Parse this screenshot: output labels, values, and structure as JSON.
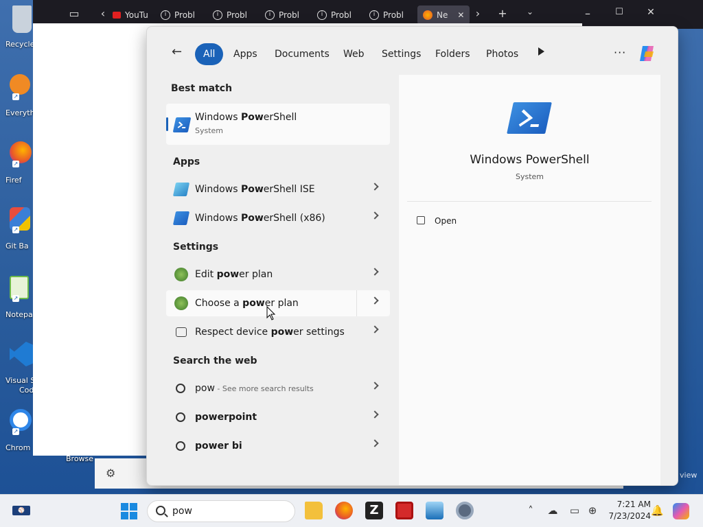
{
  "desktop": {
    "icons": [
      {
        "label": "Recycle",
        "color": "#9aa7b5"
      },
      {
        "label": "Everyth",
        "color": "#f08a24"
      },
      {
        "label": "Firef",
        "color": "#e8572a"
      },
      {
        "label": "Git Ba",
        "color": "#3b7fd6"
      },
      {
        "label": "Notepa",
        "color": "#6dbb4a"
      },
      {
        "label": "Visual S",
        "color": "#1f7bd3"
      },
      {
        "label": "Chrom",
        "color": "#2f86e8"
      }
    ],
    "label_code": "Cod",
    "label_browser": "Browse",
    "watermark": "view"
  },
  "browser": {
    "tabs": [
      {
        "label": "YouTu"
      },
      {
        "label": "Probl"
      },
      {
        "label": "Probl"
      },
      {
        "label": "Probl"
      },
      {
        "label": "Probl"
      },
      {
        "label": "Probl"
      },
      {
        "label": "Ne"
      }
    ]
  },
  "search": {
    "filters": [
      "All",
      "Apps",
      "Documents",
      "Web",
      "Settings",
      "Folders",
      "Photos"
    ],
    "best_match_title": "Best match",
    "best_match": {
      "name_pre": "Windows ",
      "name_bold": "Pow",
      "name_post": "erShell",
      "sub": "System"
    },
    "apps_title": "Apps",
    "apps": [
      {
        "pre": "Windows ",
        "bold": "Pow",
        "post": "erShell ISE"
      },
      {
        "pre": "Windows ",
        "bold": "Pow",
        "post": "erShell (x86)"
      }
    ],
    "settings_title": "Settings",
    "settings": [
      {
        "pre": "Edit ",
        "bold": "pow",
        "post": "er plan"
      },
      {
        "pre": "Choose a ",
        "bold": "pow",
        "post": "er plan"
      },
      {
        "pre": "Respect device ",
        "bold": "pow",
        "post": "er settings"
      }
    ],
    "web_title": "Search the web",
    "web": [
      {
        "pre": "pow",
        "bold": "",
        "post": "",
        "sub": " - See more search results"
      },
      {
        "pre": "",
        "bold": "powerpoint",
        "post": "",
        "sub": ""
      },
      {
        "pre": "",
        "bold": "power bi",
        "post": "",
        "sub": ""
      }
    ],
    "preview": {
      "title": "Windows PowerShell",
      "sub": "System",
      "open_label": "Open"
    }
  },
  "taskbar": {
    "search_value": "pow",
    "time": "7:21 AM",
    "date": "7/23/2024",
    "accent": "#1a62b8"
  }
}
